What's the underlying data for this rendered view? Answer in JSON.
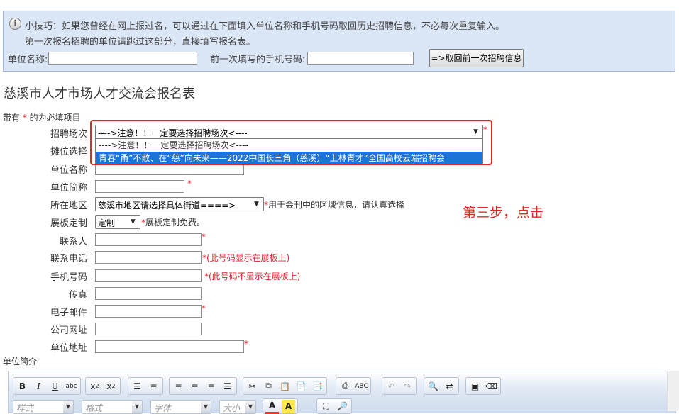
{
  "tip": {
    "line1": "小技巧：如果您曾经在网上报过名，可以通过在下面填入单位名称和手机号码取回历史招聘信息，不必每次重复输入。",
    "line2": "第一次报名招聘的单位请跳过这部分，直接填写报名表。",
    "company_label": "单位名称:",
    "phone_label": "前一次填写的手机号码:",
    "fetch_button": "=>取回前一次招聘信息"
  },
  "title": "慈溪市人才市场人才交流会报名表",
  "required_note": {
    "prefix": "带有",
    "star": "*",
    "suffix": "的为必填项目"
  },
  "form": {
    "session_label": "招聘场次",
    "session_selected": "---->注意！！一定要选择招聘场次<----",
    "session_options": [
      "---->注意！！一定要选择招聘场次<----",
      "青春“甬”不散、在“慈”向未来——2022中国长三角（慈溪）“上林青才”全国高校云端招聘会"
    ],
    "booth_label": "摊位选择",
    "company_name_label": "单位名称",
    "short_name_label": "单位简称",
    "region_label": "所在地区",
    "region_selected": "慈溪市地区请选择具体街道====>",
    "region_note": "用于会刊中的区域信息，请认真选择",
    "board_label": "展板定制",
    "board_selected": "定制",
    "board_note": "展板定制免费。",
    "contact_label": "联系人",
    "tel_label": "联系电话",
    "tel_note": "(此号码显示在展板上)",
    "mobile_label": "手机号码",
    "mobile_note": "(此号码不显示在展板上)",
    "fax_label": "传真",
    "email_label": "电子邮件",
    "website_label": "公司网址",
    "address_label": "单位地址",
    "intro_label": "单位简介"
  },
  "annotation": "第三步，点击",
  "editor": {
    "combos": [
      "样式",
      "格式",
      "字体",
      "大小"
    ]
  },
  "colors": {
    "required": "#e0202c",
    "highlight_frame": "#e3281f",
    "selected_option": "#1e73d8",
    "tip_bg": "#dbe6f7"
  }
}
